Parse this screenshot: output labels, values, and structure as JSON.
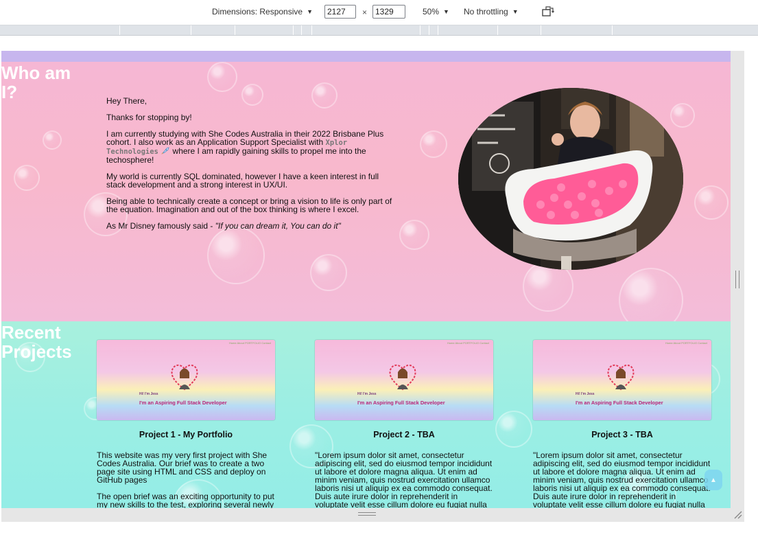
{
  "toolbar": {
    "dimensions_label": "Dimensions: Responsive",
    "width_value": "2127",
    "height_value": "1329",
    "times": "×",
    "zoom_label": "50%",
    "throttling_label": "No throttling",
    "rotate_icon": "rotate-device-icon"
  },
  "about": {
    "title": "Who am I?",
    "greeting": "Hey There,",
    "thanks": "Thanks for stopping by!",
    "p1_before": "I am currently studying with She Codes Australia in their 2022 Brisbane Plus cohort. I also work as an Application Support Specialist with ",
    "p1_company": "Xplor Technologies",
    "p1_after": " where I am rapidly gaining skills to propel me into the techosphere!",
    "p2": "My world is currently SQL dominated, however I have a keen interest in full stack development and a strong interest in UX/UI.",
    "p3": "Being able to technically create a concept or bring a vision to life is only part of the equation. Imagination and out of the box thinking is where I excel.",
    "quote_prefix": "As Mr Disney famously said - ",
    "quote": "\"If you can dream it, You can do it\""
  },
  "projects": {
    "title": "Recent Projects",
    "thumb": {
      "nav": "Home About PORTFOLIO Contact",
      "hi": "Hi! I'm Jess",
      "subtitle": "I'm an Aspiring Full Stack Developer"
    },
    "items": [
      {
        "title": "Project 1 - My Portfolio",
        "p1": "This website was my very first project with She Codes Australia. Our brief was to create a two page site using HTML and CSS and deploy on GitHub pages",
        "p2": "The open brief was an exciting opportunity to put my new skills to the test, exploring several newly concepts and effects."
      },
      {
        "title": "Project 2 - TBA",
        "p1": "\"Lorem ipsum dolor sit amet, consectetur adipiscing elit, sed do eiusmod tempor incididunt ut labore et dolore magna aliqua. Ut enim ad minim veniam, quis nostrud exercitation ullamco laboris nisi ut aliquip ex ea commodo consequat. Duis aute irure dolor in reprehenderit in voluptate velit esse cillum dolore eu fugiat nulla pariatur. Excepteur sint occaecat cupidatat non proident.",
        "p2": ""
      },
      {
        "title": "Project 3 - TBA",
        "p1": "\"Lorem ipsum dolor sit amet, consectetur adipiscing elit, sed do eiusmod tempor incididunt ut labore et dolore magna aliqua. Ut enim ad minim veniam, quis nostrud exercitation ullamco laboris nisi ut aliquip ex ea commodo consequat. Duis aute irure dolor in reprehenderit in voluptate velit esse cillum dolore eu fugiat nulla pariatur. Excepteur sint occaecat cupidatat non proident.",
        "p2": ""
      }
    ]
  },
  "back_to_top": "▲",
  "colors": {
    "about_bg": "#f6b7d4",
    "projects_bg": "#9beee4",
    "top_strip": "#c7b6ee",
    "heading_text": "#ffffff"
  }
}
